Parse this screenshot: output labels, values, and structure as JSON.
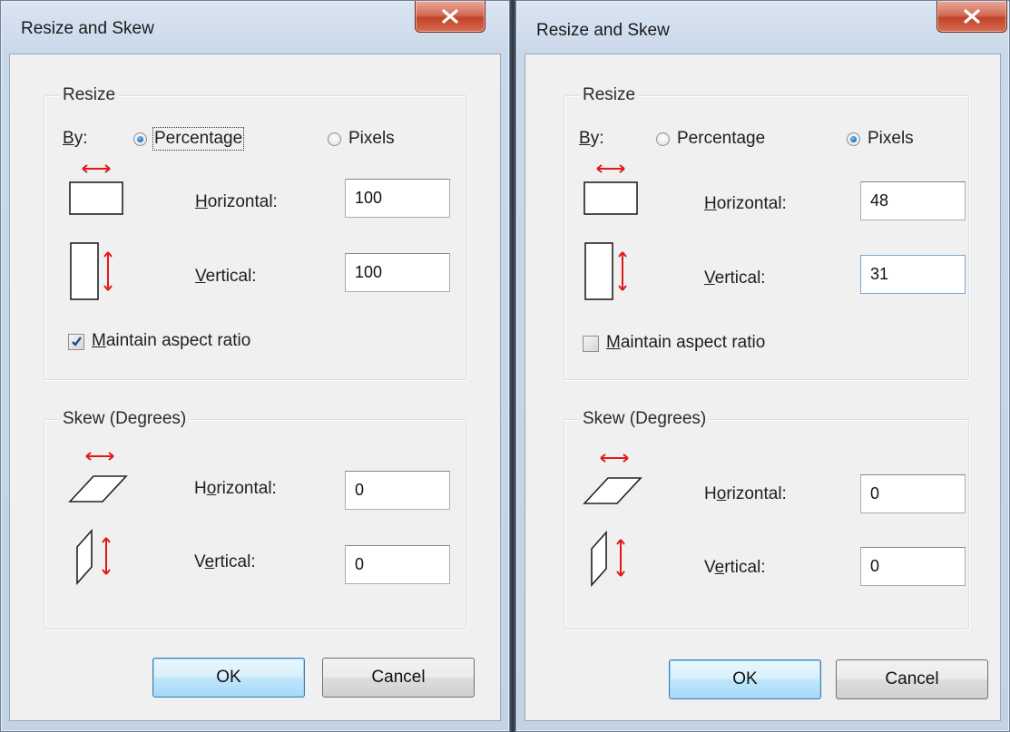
{
  "dialogs": [
    {
      "title": "Resize and Skew",
      "resize": {
        "group_title": "Resize",
        "by_label": "By:",
        "mode_options": [
          "Percentage",
          "Pixels"
        ],
        "selected_mode": "Percentage",
        "horizontal_label": "Horizontal:",
        "horizontal_value": "100",
        "vertical_label": "Vertical:",
        "vertical_value": "100",
        "maintain_label": "Maintain aspect ratio",
        "maintain_checked": true
      },
      "skew": {
        "group_title": "Skew (Degrees)",
        "horizontal_label": "Horizontal:",
        "horizontal_value": "0",
        "vertical_label": "Vertical:",
        "vertical_value": "0"
      },
      "ok_label": "OK",
      "cancel_label": "Cancel"
    },
    {
      "title": "Resize and Skew",
      "resize": {
        "group_title": "Resize",
        "by_label": "By:",
        "mode_options": [
          "Percentage",
          "Pixels"
        ],
        "selected_mode": "Pixels",
        "horizontal_label": "Horizontal:",
        "horizontal_value": "48",
        "vertical_label": "Vertical:",
        "vertical_value": "31",
        "maintain_label": "Maintain aspect ratio",
        "maintain_checked": false
      },
      "skew": {
        "group_title": "Skew (Degrees)",
        "horizontal_label": "Horizontal:",
        "horizontal_value": "0",
        "vertical_label": "Vertical:",
        "vertical_value": "0"
      },
      "ok_label": "OK",
      "cancel_label": "Cancel"
    }
  ],
  "colors": {
    "arrow_red": "#e01818",
    "close_button_red": "#c2442c",
    "default_button_blue": "#3c7fb1"
  }
}
